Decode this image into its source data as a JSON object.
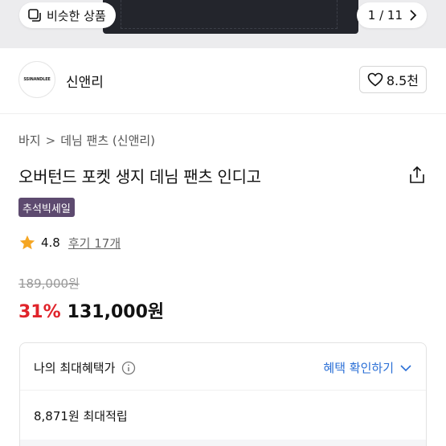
{
  "carousel": {
    "similar_label": "비슷한 상품",
    "page_current": "1",
    "page_total": "11",
    "page_text": "1 / 11"
  },
  "store": {
    "logo_text": "SSINANDLEE",
    "name": "신앤리",
    "likes": "8.5천"
  },
  "breadcrumb": {
    "category": "바지",
    "subcategory": "데님 팬츠 (신앤리)"
  },
  "product": {
    "title": "오버턴드 포켓 생지 데님 팬츠 인디고",
    "badge": "추석빅세일",
    "rating": "4.8",
    "reviews": "후기 17개",
    "original_price": "189,000원",
    "discount": "31%",
    "price": "131,000원"
  },
  "benefits": {
    "heading": "나의 최대혜택가",
    "check_link": "혜택 확인하기",
    "points": "8,871원 최대적립"
  },
  "colors": {
    "accent_blue": "#2a6fd6",
    "discount_red": "#e0242b",
    "badge_purple": "#5d4a6f",
    "star_yellow": "#f5a623"
  }
}
